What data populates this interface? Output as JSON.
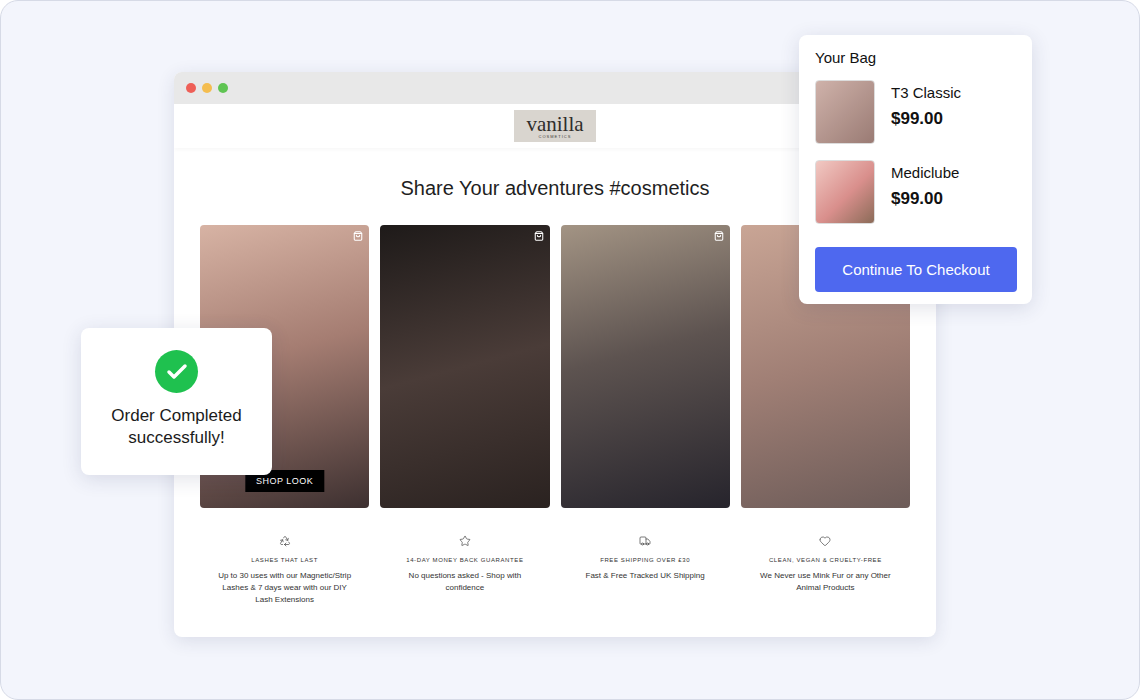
{
  "browser": {
    "dots": [
      {
        "color": "#ee5f57"
      },
      {
        "color": "#f4bd4f"
      },
      {
        "color": "#5fc453"
      }
    ]
  },
  "logo": {
    "name": "vanilla",
    "tagline": "COSMETICS"
  },
  "heading": "Share Your adventures #cosmetics",
  "gallery": [
    {
      "shop_button": "SHOP LOOK"
    },
    {
      "shop_button": ""
    },
    {
      "shop_button": ""
    },
    {
      "shop_button": ""
    }
  ],
  "features": [
    {
      "icon": "recycle",
      "title": "LASHES THAT LAST",
      "text": "Up to 30 uses with our Magnetic/Strip Lashes & 7 days wear with our DIY Lash Extensions"
    },
    {
      "icon": "star",
      "title": "14-DAY MONEY BACK GUARANTEE",
      "text": "No questions asked - Shop with confidence"
    },
    {
      "icon": "truck",
      "title": "FREE SHIPPING OVER £30",
      "text": "Fast & Free Tracked UK Shipping"
    },
    {
      "icon": "heart",
      "title": "CLEAN, VEGAN & CRUELTY-FREE",
      "text": "We Never use Mink Fur or any Other Animal Products"
    }
  ],
  "toast": {
    "message": "Order Completed successfully!"
  },
  "bag": {
    "title": "Your Bag",
    "items": [
      {
        "name": "T3 Classic",
        "price": "$99.00"
      },
      {
        "name": "Mediclube",
        "price": "$99.00"
      }
    ],
    "button": "Continue To Checkout"
  }
}
